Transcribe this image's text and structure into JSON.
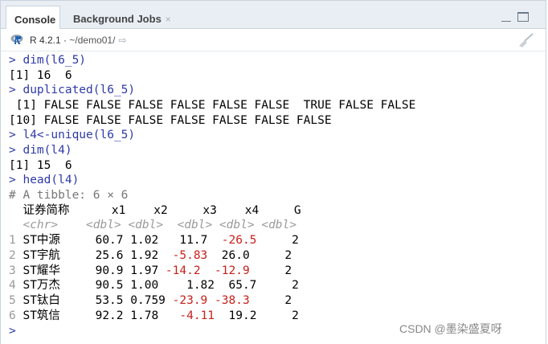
{
  "tabs": [
    {
      "label": "Console"
    },
    {
      "label": "Background Jobs",
      "close": "×"
    }
  ],
  "toolbar": {
    "r_version": "R 4.2.1",
    "separator": "·",
    "path": "~/demo01/",
    "arrow": "⇨"
  },
  "console": [
    {
      "prompt": ">",
      "text": " dim(l6_5)"
    },
    {
      "out": "[1] 16  6"
    },
    {
      "prompt": ">",
      "text": " duplicated(l6_5)"
    },
    {
      "out": " [1] FALSE FALSE FALSE FALSE FALSE FALSE  TRUE FALSE FALSE"
    },
    {
      "out": "[10] FALSE FALSE FALSE FALSE FALSE FALSE FALSE"
    },
    {
      "prompt": ">",
      "text": " l4<-unique(l6_5)"
    },
    {
      "prompt": ">",
      "text": " dim(l4)"
    },
    {
      "out": "[1] 15  6"
    },
    {
      "prompt": ">",
      "text": " head(l4)"
    },
    {
      "comment": "# A tibble: 6 × 6"
    }
  ],
  "table": {
    "headers": [
      "证券简称",
      "x1",
      "x2",
      "x3",
      "x4",
      "G"
    ],
    "types": [
      "<chr>",
      "<dbl>",
      "<dbl>",
      "<dbl>",
      "<dbl>",
      "<dbl>"
    ],
    "rows": [
      {
        "idx": "1",
        "name": "ST中源",
        "x1": "60.7",
        "x2": "1.02",
        "x3": "11.7",
        "x4": "-26.5",
        "g": "2"
      },
      {
        "idx": "2",
        "name": "ST宇航",
        "x1": "25.6",
        "x2": "1.92",
        "x3": "-5.83",
        "x4": "26.0",
        "g": "2"
      },
      {
        "idx": "3",
        "name": "ST耀华",
        "x1": "90.9",
        "x2": "1.97",
        "x3": "-14.2",
        "x4": "-12.9",
        "g": "2"
      },
      {
        "idx": "4",
        "name": "ST万杰",
        "x1": "90.5",
        "x2": "1.00",
        "x3": "1.82",
        "x4": "65.7",
        "g": "2"
      },
      {
        "idx": "5",
        "name": "ST钛白",
        "x1": "53.5",
        "x2": "0.759",
        "x3": "-23.9",
        "x4": "-38.3",
        "g": "2"
      },
      {
        "idx": "6",
        "name": "ST筑信",
        "x1": "92.2",
        "x2": "1.78",
        "x3": "-4.11",
        "x4": "19.2",
        "g": "2"
      }
    ]
  },
  "final_prompt": ">",
  "watermark": "CSDN @墨染盛夏呀"
}
